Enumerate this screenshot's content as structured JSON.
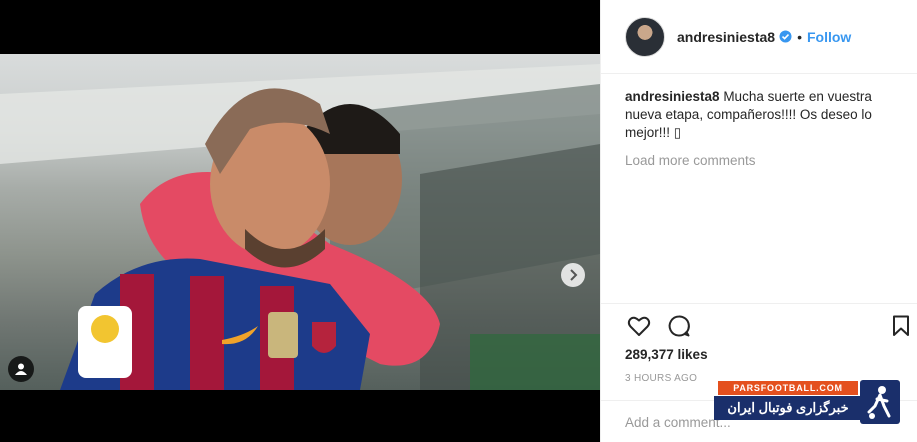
{
  "post": {
    "username": "andresiniesta8",
    "follow_label": "Follow",
    "separator": "•",
    "caption_user": "andresiniesta8",
    "caption_text": "Mucha suerte en vuestra nueva etapa, compañeros!!!! Os deseo lo mejor!!! ▯",
    "load_more": "Load more comments",
    "likes": "289,377 likes",
    "time": "3 HOURS AGO",
    "comment_placeholder": "Add a comment..."
  },
  "carousel": {
    "slide_count": 2,
    "active_index": 0
  },
  "watermark": {
    "site": "PARSFOOTBALL.COM",
    "tagline": "خبرگزاری فوتبال ایران"
  },
  "icons": {
    "verified": "verified-badge-icon",
    "like": "heart-icon",
    "comment": "comment-bubble-icon",
    "save": "bookmark-icon",
    "next": "chevron-right-icon",
    "tagged": "user-tag-icon"
  },
  "colors": {
    "accent": "#3897f0",
    "muted": "#999999",
    "text": "#262626",
    "watermark_orange": "#e4501e",
    "watermark_blue": "#1a2f6b"
  }
}
